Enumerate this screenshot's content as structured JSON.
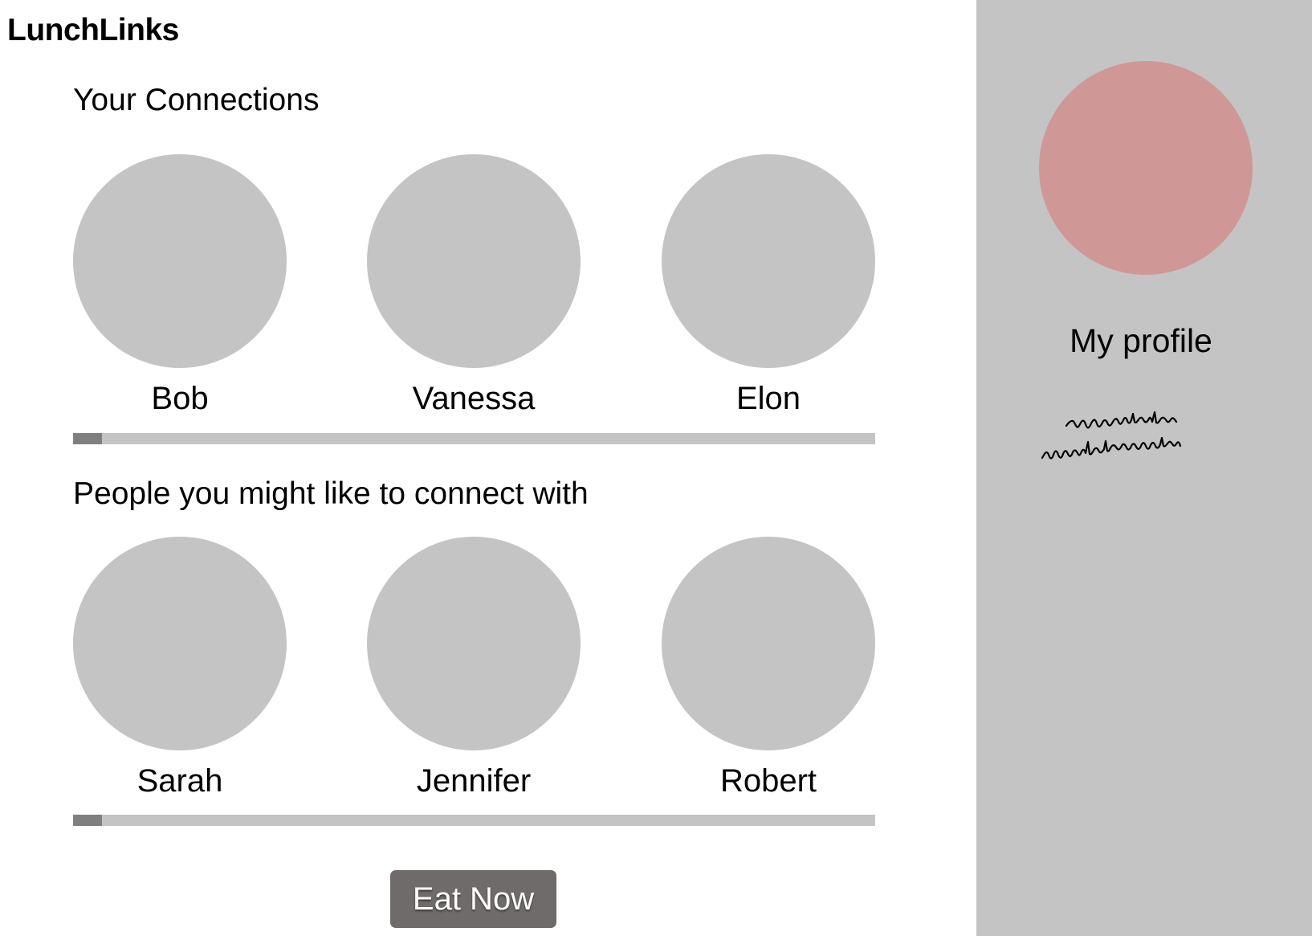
{
  "app": {
    "title": "LunchLinks"
  },
  "colors": {
    "background": "#ffffff",
    "avatar_placeholder": "#c4c4c4",
    "sidebar_background": "#c4c4c4",
    "profile_avatar": "#d09797",
    "scroll_track": "#c4c4c4",
    "scroll_thumb": "#7f7f7f",
    "button_background": "#706b6b",
    "button_text": "#ffffff"
  },
  "connections": {
    "heading": "Your Connections",
    "people": [
      {
        "name": "Bob"
      },
      {
        "name": "Vanessa"
      },
      {
        "name": "Elon"
      }
    ],
    "scroll_position": 0
  },
  "suggestions": {
    "heading": "People you might like to connect with",
    "people": [
      {
        "name": "Sarah"
      },
      {
        "name": "Jennifer"
      },
      {
        "name": "Robert"
      }
    ],
    "scroll_position": 0
  },
  "actions": {
    "eat_now_label": "Eat Now"
  },
  "sidebar": {
    "profile_label": "My profile",
    "avatar_icon": "profile-avatar-icon"
  }
}
